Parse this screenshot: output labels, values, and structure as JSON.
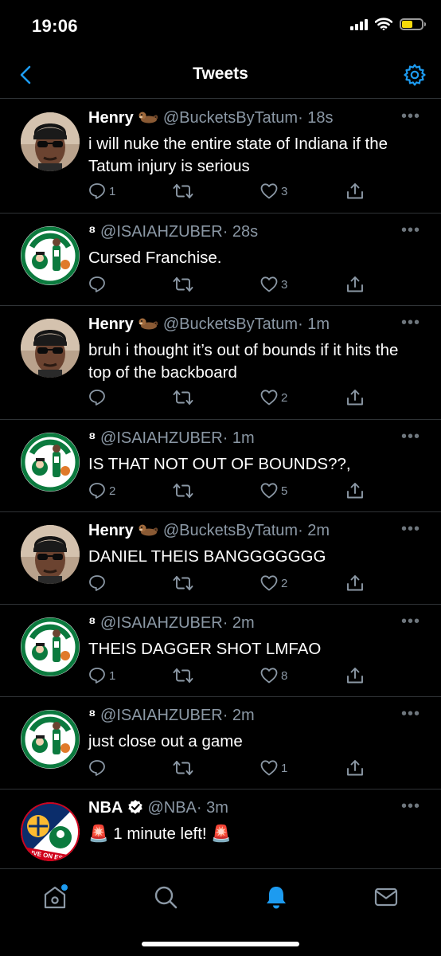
{
  "status_bar": {
    "time": "19:06",
    "battery_level": 0.55
  },
  "nav": {
    "title": "Tweets"
  },
  "tweets": [
    {
      "avatar": "person-sunglasses-durag",
      "name": "Henry",
      "emoji": "otter-emoji",
      "handle": "@BucketsByTatum",
      "time": "· 18s",
      "text": "i will nuke the entire state of Indiana if the Tatum injury is serious",
      "reply_count": "1",
      "retweet_count": "",
      "like_count": "3"
    },
    {
      "avatar": "celtics-logo-jayson-tatum",
      "name": "⁸",
      "emoji": "",
      "handle": "@ISAIAHZUBER",
      "time": "· 28s",
      "text": "Cursed Franchise.",
      "reply_count": "",
      "retweet_count": "",
      "like_count": "3"
    },
    {
      "avatar": "person-sunglasses-durag",
      "name": "Henry",
      "emoji": "otter-emoji",
      "handle": "@BucketsByTatum",
      "time": "· 1m",
      "text": "bruh i thought it’s out of bounds if it hits the top of the backboard",
      "reply_count": "",
      "retweet_count": "",
      "like_count": "2"
    },
    {
      "avatar": "celtics-logo-jayson-tatum",
      "name": "⁸",
      "emoji": "",
      "handle": "@ISAIAHZUBER",
      "time": "· 1m",
      "text": "IS THAT NOT OUT OF BOUNDS??,",
      "reply_count": "2",
      "retweet_count": "",
      "like_count": "5"
    },
    {
      "avatar": "person-sunglasses-durag",
      "name": "Henry",
      "emoji": "otter-emoji",
      "handle": "@BucketsByTatum",
      "time": "· 2m",
      "text": "DANIEL THEIS BANGGGGGGG",
      "reply_count": "",
      "retweet_count": "",
      "like_count": "2"
    },
    {
      "avatar": "celtics-logo-jayson-tatum",
      "name": "⁸",
      "emoji": "",
      "handle": "@ISAIAHZUBER",
      "time": "· 2m",
      "text": "THEIS DAGGER SHOT LMFAO",
      "reply_count": "1",
      "retweet_count": "",
      "like_count": "8"
    },
    {
      "avatar": "celtics-logo-jayson-tatum",
      "name": "⁸",
      "emoji": "",
      "handle": "@ISAIAHZUBER",
      "time": "· 2m",
      "text": "just close out a game",
      "reply_count": "",
      "retweet_count": "",
      "like_count": "1"
    },
    {
      "avatar": "nba-pacers-celtics-live-on-espn",
      "avatar_text": "LIVE ON ESPN",
      "name": "NBA",
      "verified": true,
      "handle": "@NBA",
      "time": "· 3m",
      "text": "🚨 1 minute left! 🚨"
    }
  ],
  "tabbar": {
    "items": [
      "home-icon",
      "search-icon",
      "notifications-icon",
      "messages-icon"
    ],
    "active": "notifications-icon"
  },
  "colors": {
    "accent": "#1d9bf0",
    "secondary_text": "#8b98a5",
    "divider": "#2f3336",
    "background": "#000000"
  }
}
